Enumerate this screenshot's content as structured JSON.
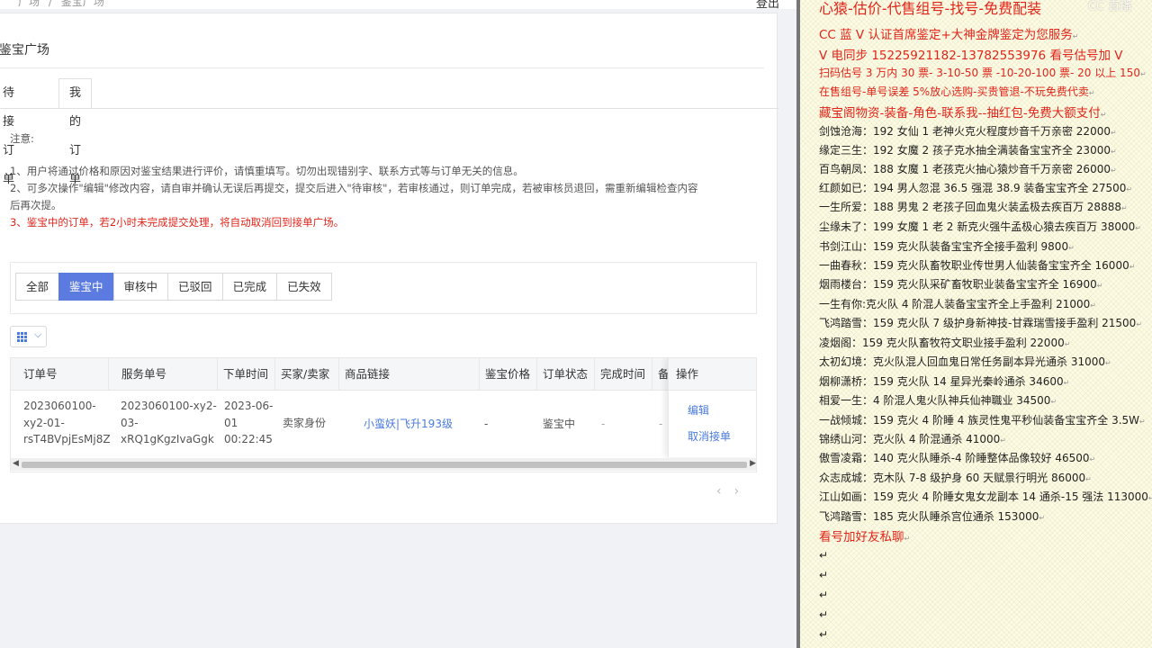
{
  "header": {
    "breadcrumb": [
      "广场",
      "/",
      "鉴宝广场"
    ],
    "logout": "登出"
  },
  "page_title": "鉴宝广场",
  "tabs": [
    {
      "label": "待接订单"
    },
    {
      "label": "我的订单"
    }
  ],
  "notice": {
    "title": "注意:",
    "lines": [
      "1、用户将通过价格和原因对鉴宝结果进行评价，请慎重填写。切勿出现错别字、联系方式等与订单无关的信息。",
      "2、可多次操作\"编辑\"修改内容，请自审并确认无误后再提交，提交后进入\"待审核\"，若审核通过，则订单完成，若被审核员退回，需重新编辑检查内容",
      "后再次提。",
      "3、鉴宝中的订单，若2小时未完成提交处理，将自动取消回到接单广场。"
    ]
  },
  "filters": [
    "全部",
    "鉴宝中",
    "审核中",
    "已驳回",
    "已完成",
    "已失效"
  ],
  "table": {
    "headers": [
      "订单号",
      "服务单号",
      "下单时间",
      "买家/卖家",
      "商品链接",
      "鉴宝价格",
      "订单状态",
      "完成时间",
      "备",
      "操作"
    ],
    "row": {
      "order_no": [
        "2023060100-",
        "xy2-01-",
        "rsT4BVpjEsMj8Z"
      ],
      "service_no": [
        "2023060100-xy2-",
        "03-",
        "xRQ1gKgzIvaGgk"
      ],
      "time": [
        "2023-06-",
        "01",
        "00:22:45"
      ],
      "role": "卖家身份",
      "link": "小蛮妖|飞升193级",
      "price": "-",
      "status": "鉴宝中",
      "finish": "-",
      "remark": "-",
      "op_edit": "编辑",
      "op_cancel": "取消接单"
    }
  },
  "pager": {
    "prev": "‹",
    "next": "›"
  },
  "doc": {
    "watermark": "CC 直播",
    "header_lines": [
      "心猿-估价-代售组号-找号-免费配装",
      "CC 蓝 V 认证首席鉴定+大神金牌鉴定为您服务",
      "V 电同步 15225921182-13782553976 看号估号加 V",
      "扫码估号 3 万内 30 票- 3-10-50 票 -10-20-100 票- 20 以上 150",
      "在售组号-单号误差 5%放心选购-买贵管退-不玩免费代卖",
      "藏宝阁物资-装备-角色-联系我--抽红包-免费大额支付"
    ],
    "listings": [
      "剑蚀沧海：192 女仙 1 老神火克火程度炒音千万亲密 22000",
      "缘定三生：192 女魔 2 孩子克水抽全满装备宝宝齐全 23000",
      "百鸟朝凤：188 女魔 1 老孩克火抽心猿炒音千万亲密 26000",
      "红颜如已：194 男人忽混 36.5 强混 38.9 装备宝宝齐全 27500",
      "一生所爱：188 男鬼 2 老孩子回血鬼火装孟极去疾百万 28888",
      "尘缘未了：199 女魔 1 老 2 新克火强牛孟极心猿去疾百万 38000",
      "书剑江山：159 克火队装备宝宝齐全接手盈利 9800",
      "一曲春秋：159 克火队畜牧职业传世男人仙装备宝宝齐全 16000",
      "烟雨楼台：159 克火队采矿畜牧职业装备宝宝齐全 16900",
      "一生有你:克火队 4 阶混人装备宝宝齐全上手盈利 21000",
      "飞鸿踏雪：159 克火队 7 级护身新神技-甘霖瑞雪接手盈利 21500",
      "凌烟阁：159 克火队畜牧符文职业接手盈利 22000",
      "太初幻境：克火队混人回血鬼日常任务副本异光通杀 31000",
      "烟柳潇桥：159 克火队 14 星异光秦岭通杀 34600",
      "相爱一生：4 阶混人鬼火队神兵仙神職业 34500",
      "一战倾城：159 克火 4 阶睡 4 族灵性鬼平秒仙装备宝宝齐全 3.5W",
      "锦绣山河：克火队 4 阶混通杀 41000",
      "傲雪凌霜：140 克火队睡杀-4 阶睡整体品像较好 46500",
      "众志成城：克木队 7-8 级护身 60 天赋景行明光 86000",
      "江山如画：159 克火 4 阶睡女鬼女龙副本 14 通杀-15 强法 113000",
      "飞鸿踏雪：185 克火队睡杀宫位通杀 153000"
    ],
    "footer": "看号加好友私聊",
    "para_mark": "↵"
  }
}
